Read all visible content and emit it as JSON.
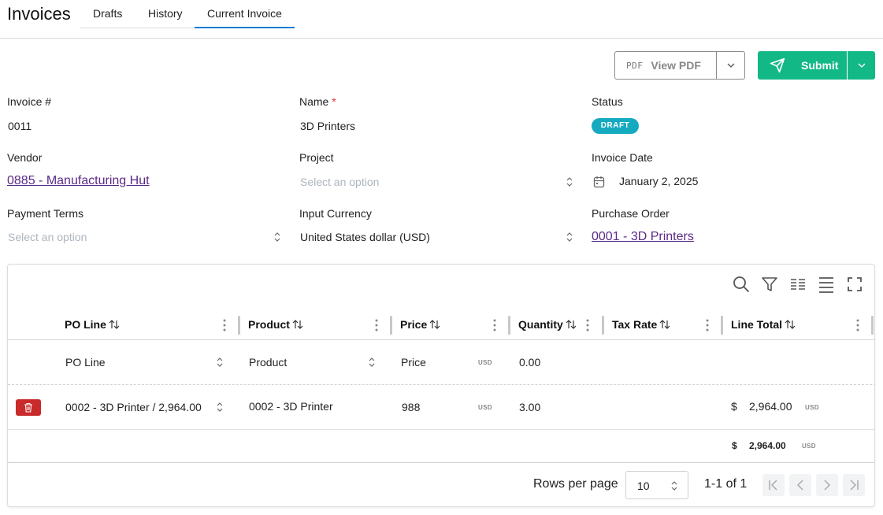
{
  "header": {
    "title": "Invoices",
    "tabs": [
      {
        "label": "Drafts"
      },
      {
        "label": "History"
      },
      {
        "label": "Current Invoice",
        "active": true
      }
    ]
  },
  "actions": {
    "pdf_glyph": "PDF",
    "view_pdf_label": "View PDF",
    "submit_label": "Submit",
    "accent_color": "#12b886"
  },
  "fields": {
    "invoice_number": {
      "label": "Invoice #",
      "value": "0011"
    },
    "name": {
      "label": "Name",
      "required_mark": "*",
      "value": "3D Printers"
    },
    "status": {
      "label": "Status",
      "value": "DRAFT",
      "color": "#15aabf"
    },
    "vendor": {
      "label": "Vendor",
      "value": "0885 - Manufacturing Hut"
    },
    "project": {
      "label": "Project",
      "placeholder": "Select an option"
    },
    "invoice_date": {
      "label": "Invoice Date",
      "value": "January 2, 2025"
    },
    "payment_terms": {
      "label": "Payment Terms",
      "placeholder": "Select an option"
    },
    "input_currency": {
      "label": "Input Currency",
      "value": "United States dollar (USD)"
    },
    "purchase_order": {
      "label": "Purchase Order",
      "value": "0001 - 3D Printers"
    }
  },
  "table": {
    "columns": [
      {
        "label": "PO Line"
      },
      {
        "label": "Product"
      },
      {
        "label": "Price"
      },
      {
        "label": "Quantity"
      },
      {
        "label": "Tax Rate"
      },
      {
        "label": "Line Total"
      }
    ],
    "new_row": {
      "po_line_placeholder": "PO Line",
      "product_placeholder": "Product",
      "price_placeholder": "Price",
      "currency": "USD",
      "quantity": "0.00"
    },
    "rows": [
      {
        "po_line": "0002 - 3D Printer / 2,964.00",
        "product": "0002 - 3D Printer",
        "price": "988",
        "price_currency": "USD",
        "quantity": "3.00",
        "line_total_symbol": "$",
        "line_total": "2,964.00",
        "line_total_currency": "USD"
      }
    ],
    "totals": {
      "symbol": "$",
      "line_total": "2,964.00",
      "currency": "USD"
    },
    "pagination": {
      "rows_per_page_label": "Rows per page",
      "rows_per_page": "10",
      "range": "1-1 of 1"
    }
  }
}
